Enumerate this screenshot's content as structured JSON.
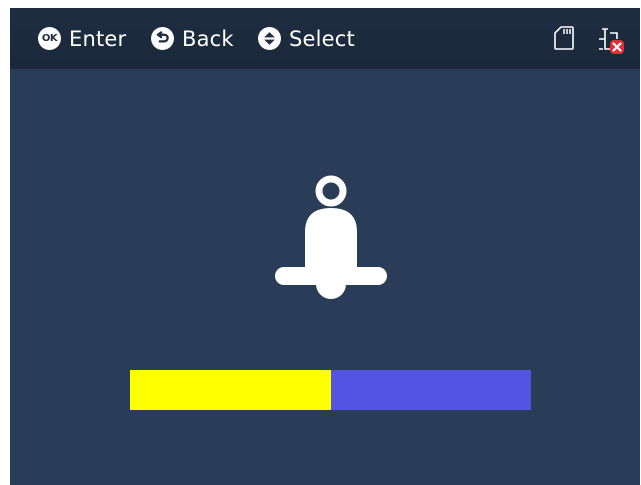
{
  "header": {
    "hints": [
      {
        "icon": "ok-button-icon",
        "glyph": "OK",
        "label": "Enter"
      },
      {
        "icon": "back-arrow-icon",
        "label": "Back"
      },
      {
        "icon": "up-down-select-icon",
        "label": "Select"
      }
    ],
    "status_icons": [
      "sd-card-icon",
      "network-disconnected-icon"
    ]
  },
  "main": {
    "icon": "bell-icon",
    "progress": {
      "value_fraction": 0.5,
      "fill_color": "#ffff00",
      "track_color": "#5454e3"
    }
  },
  "colors": {
    "background": "#293d58",
    "header": "#1e2d42",
    "foreground": "#ffffff",
    "alert": "#e03030"
  }
}
